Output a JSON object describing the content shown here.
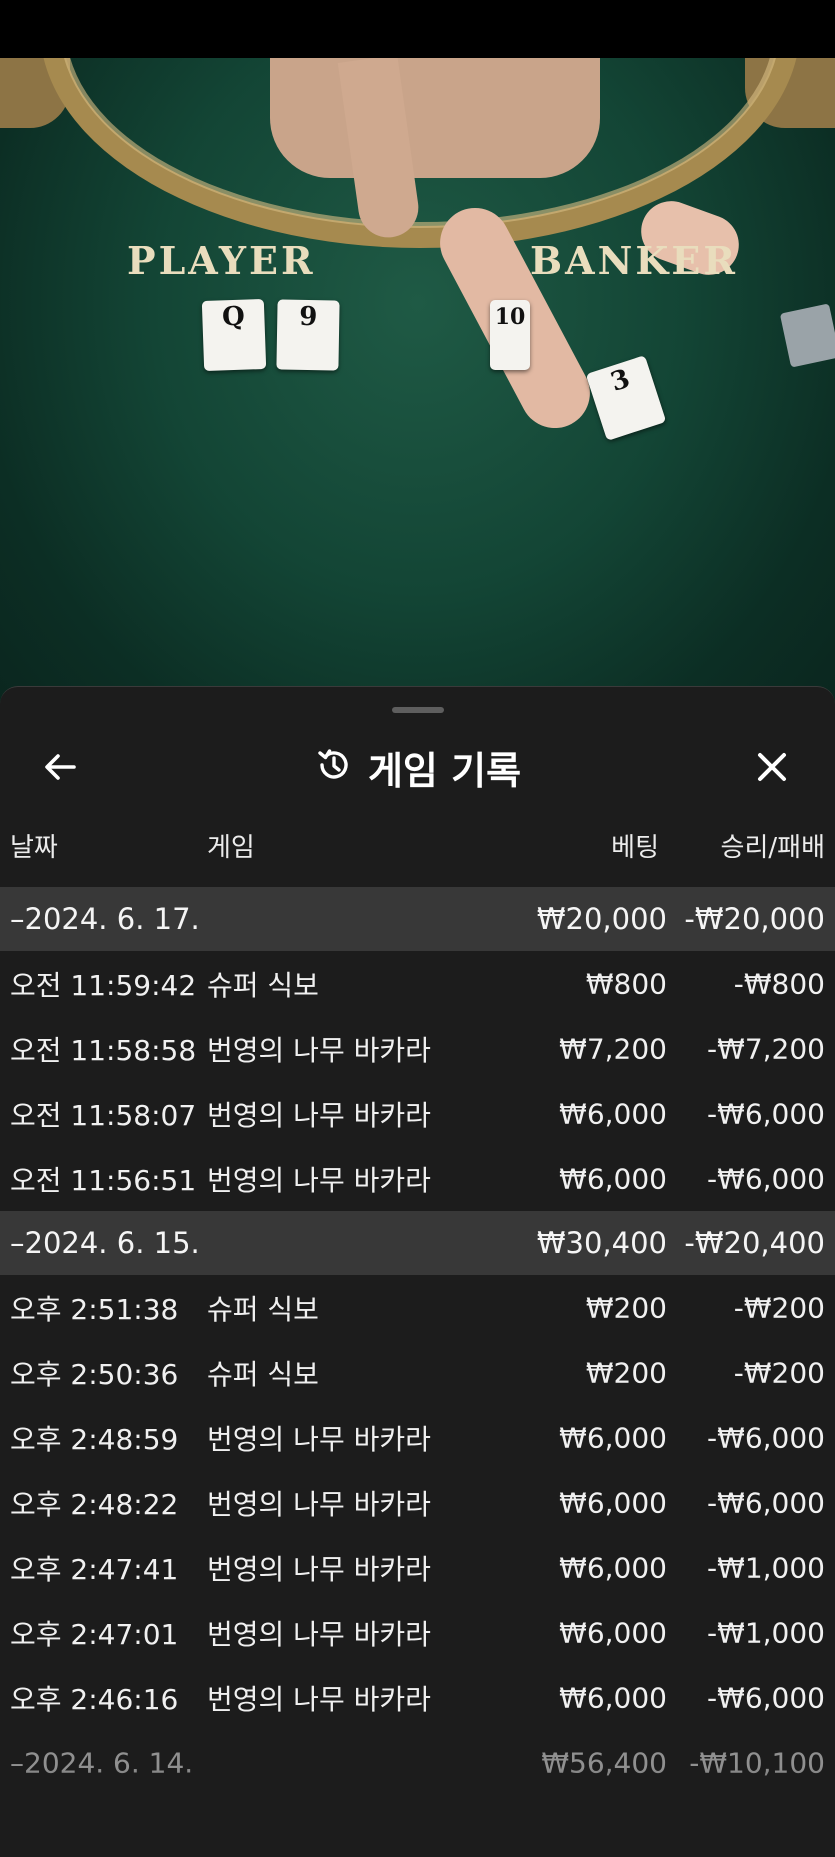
{
  "video": {
    "player_label": "PLAYER",
    "banker_label": "BANKER",
    "player_cards": [
      "Q",
      "9"
    ],
    "banker_cards": [
      "10",
      "3"
    ]
  },
  "history": {
    "title": "게임 기록",
    "title_icon": "history-icon",
    "back_icon": "arrow-left-icon",
    "close_icon": "close-icon",
    "columns": {
      "date": "날짜",
      "game": "게임",
      "bet": "베팅",
      "win_loss": "승리/패배"
    },
    "groups": [
      {
        "date": "–2024. 6. 17.",
        "bet_total": "₩20,000",
        "wl_total": "-₩20,000",
        "rows": [
          {
            "time": "오전 11:59:42",
            "game": "슈퍼 식보",
            "bet": "₩800",
            "wl": "-₩800"
          },
          {
            "time": "오전 11:58:58",
            "game": "번영의 나무 바카라",
            "bet": "₩7,200",
            "wl": "-₩7,200"
          },
          {
            "time": "오전 11:58:07",
            "game": "번영의 나무 바카라",
            "bet": "₩6,000",
            "wl": "-₩6,000"
          },
          {
            "time": "오전 11:56:51",
            "game": "번영의 나무 바카라",
            "bet": "₩6,000",
            "wl": "-₩6,000"
          }
        ]
      },
      {
        "date": "–2024. 6. 15.",
        "bet_total": "₩30,400",
        "wl_total": "-₩20,400",
        "rows": [
          {
            "time": "오후 2:51:38",
            "game": "슈퍼 식보",
            "bet": "₩200",
            "wl": "-₩200"
          },
          {
            "time": "오후 2:50:36",
            "game": "슈퍼 식보",
            "bet": "₩200",
            "wl": "-₩200"
          },
          {
            "time": "오후 2:48:59",
            "game": "번영의 나무 바카라",
            "bet": "₩6,000",
            "wl": "-₩6,000"
          },
          {
            "time": "오후 2:48:22",
            "game": "번영의 나무 바카라",
            "bet": "₩6,000",
            "wl": "-₩6,000"
          },
          {
            "time": "오후 2:47:41",
            "game": "번영의 나무 바카라",
            "bet": "₩6,000",
            "wl": "-₩1,000"
          },
          {
            "time": "오후 2:47:01",
            "game": "번영의 나무 바카라",
            "bet": "₩6,000",
            "wl": "-₩1,000"
          },
          {
            "time": "오후 2:46:16",
            "game": "번영의 나무 바카라",
            "bet": "₩6,000",
            "wl": "-₩6,000"
          }
        ]
      },
      {
        "date": "–2024. 6. 14.",
        "bet_total": "₩56,400",
        "wl_total": "-₩10,100",
        "rows": []
      }
    ]
  }
}
